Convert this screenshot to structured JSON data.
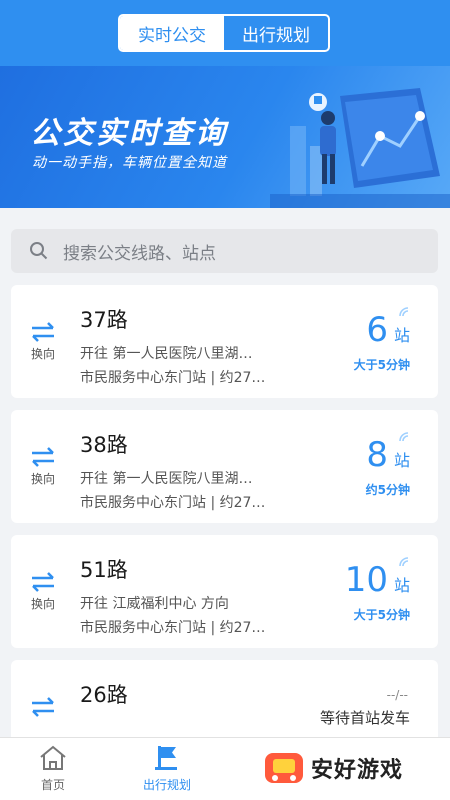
{
  "header": {
    "tabs": [
      {
        "label": "实时公交",
        "active": true
      },
      {
        "label": "出行规划",
        "active": false
      }
    ],
    "accent": "#2f8ff0"
  },
  "banner": {
    "title": "公交实时查询",
    "subtitle": "动一动手指，车辆位置全知道"
  },
  "search": {
    "placeholder": "搜索公交线路、站点"
  },
  "routes": [
    {
      "swap_label": "换向",
      "name": "37路",
      "direction": "开往 第一人民医院八里湖…",
      "stop": "市民服务中心东门站 | 约27…",
      "stops": "6",
      "unit": "站",
      "eta": "大于5分钟"
    },
    {
      "swap_label": "换向",
      "name": "38路",
      "direction": "开往 第一人民医院八里湖…",
      "stop": "市民服务中心东门站 | 约27…",
      "stops": "8",
      "unit": "站",
      "eta": "约5分钟"
    },
    {
      "swap_label": "换向",
      "name": "51路",
      "direction": "开往 江威福利中心 方向",
      "stop": "市民服务中心东门站 | 约27…",
      "stops": "10",
      "unit": "站",
      "eta": "大于5分钟"
    },
    {
      "swap_label": "换向",
      "name": "26路",
      "dash": "--/--",
      "status": "等待首站发车"
    }
  ],
  "bottom_nav": [
    {
      "label": "首页",
      "icon": "home-icon",
      "active": false
    },
    {
      "label": "出行规划",
      "icon": "flag-icon",
      "active": true
    }
  ],
  "watermark": {
    "text": "安好游戏"
  }
}
